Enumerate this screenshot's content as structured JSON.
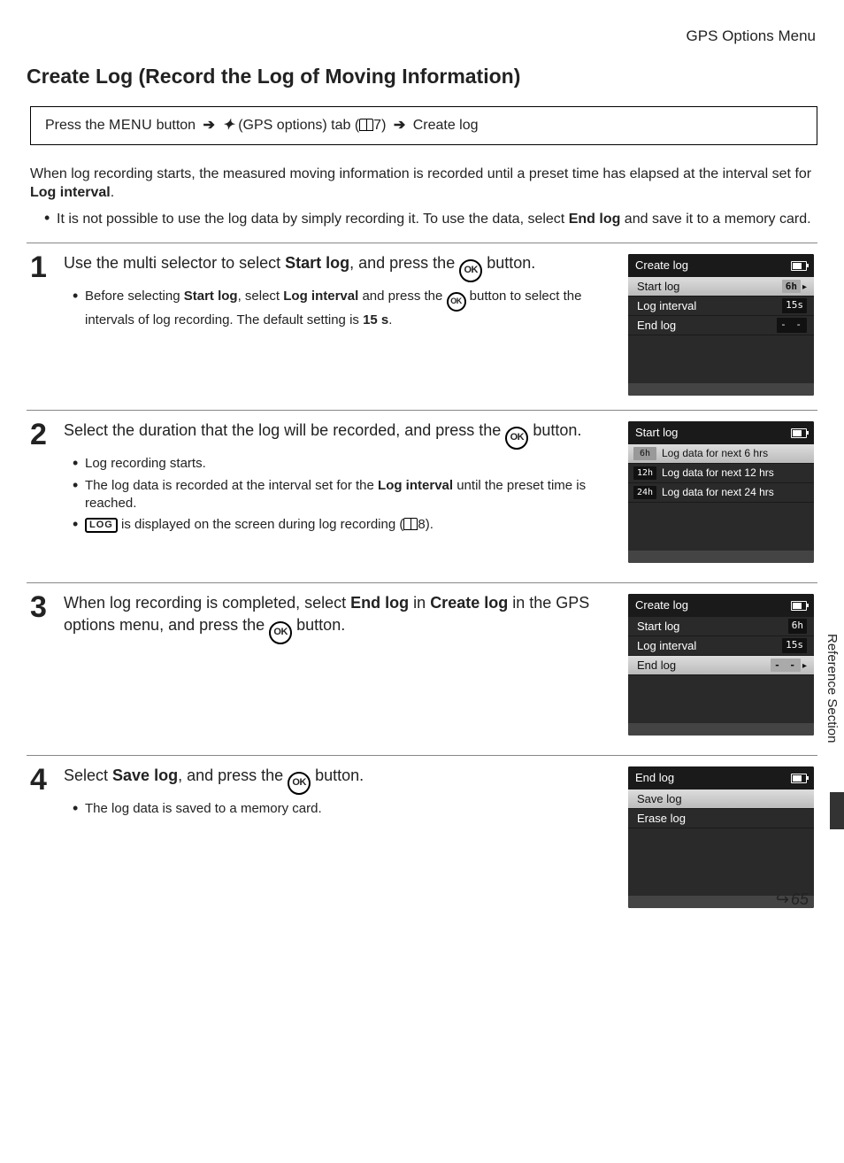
{
  "breadcrumb": "GPS Options Menu",
  "title": "Create Log (Record the Log of Moving Information)",
  "nav": {
    "press_the": "Press the ",
    "menu": "MENU",
    "button": " button ",
    "gps_tab": " (GPS options) tab (",
    "page7": "7) ",
    "create_log": " Create log"
  },
  "intro": {
    "p1a": "When log recording starts, the measured moving information is recorded until a preset time has elapsed at the interval set for ",
    "p1b": "Log interval",
    "b1a": "It is not possible to use the log data by simply recording it. To use the data, select ",
    "b1b": "End log",
    "b1c": " and save it to a memory card."
  },
  "steps": {
    "s1": {
      "main_a": "Use the multi selector to select ",
      "main_b": "Start log",
      "main_c": ", and press the ",
      "main_d": " button.",
      "sub_a": "Before selecting ",
      "sub_b": "Start log",
      "sub_c": ", select ",
      "sub_d": "Log interval",
      "sub_e": " and press the ",
      "sub_f": " button to select the intervals of log recording. The default setting is ",
      "sub_g": "15 s",
      "sub_h": "."
    },
    "s2": {
      "main_a": "Select the duration that the log will be recorded, and press the ",
      "main_b": " button.",
      "sub1": "Log recording starts.",
      "sub2_a": "The log data is recorded at the interval set for the ",
      "sub2_b": "Log interval",
      "sub2_c": " until the preset time is reached.",
      "sub3_a": " is displayed on the screen during log recording (",
      "sub3_b": "8)."
    },
    "s3": {
      "main_a": "When log recording is completed, select ",
      "main_b": "End log",
      "main_c": " in ",
      "main_d": "Create log",
      "main_e": " in the GPS options menu, and press the ",
      "main_f": " button."
    },
    "s4": {
      "main_a": "Select ",
      "main_b": "Save log",
      "main_c": ", and press the ",
      "main_d": " button.",
      "sub1": "The log data is saved to a memory card."
    }
  },
  "screens": {
    "create_log": {
      "title": "Create log",
      "r1": "Start log",
      "v1": "6h",
      "r2": "Log interval",
      "v2": "15s",
      "r3": "End log"
    },
    "start_log": {
      "title": "Start log",
      "o1t": "6h",
      "o1": "Log data for next 6 hrs",
      "o2t": "12h",
      "o2": "Log data for next 12 hrs",
      "o3t": "24h",
      "o3": "Log data for next 24 hrs"
    },
    "end_log": {
      "title": "End log",
      "r1": "Save log",
      "r2": "Erase log"
    }
  },
  "side_tab": "Reference Section",
  "page_num": "65",
  "ok_label": "OK",
  "log_label": "LOG"
}
